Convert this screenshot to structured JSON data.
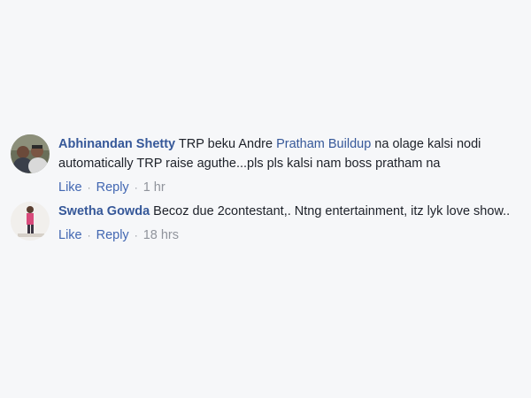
{
  "comments": [
    {
      "author": "Abhinandan Shetty",
      "text_before": " TRP beku Andre ",
      "mention": "Pratham Buildup",
      "text_after": " na olage kalsi nodi automatically TRP raise aguthe...pls pls kalsi nam boss pratham na",
      "like": "Like",
      "reply": "Reply",
      "time": "1 hr",
      "avatar_icon": "avatar-photo-two-men"
    },
    {
      "author": "Swetha Gowda",
      "text_before": " Becoz due 2contestant,. Ntng entertainment, itz lyk love show..",
      "mention": "",
      "text_after": "",
      "like": "Like",
      "reply": "Reply",
      "time": "18 hrs",
      "avatar_icon": "avatar-photo-woman-standing"
    }
  ],
  "separator": "·",
  "colors": {
    "background": "#f6f7f9",
    "author": "#365899",
    "link": "#4267b2",
    "text": "#1d2129",
    "muted": "#90949c"
  }
}
